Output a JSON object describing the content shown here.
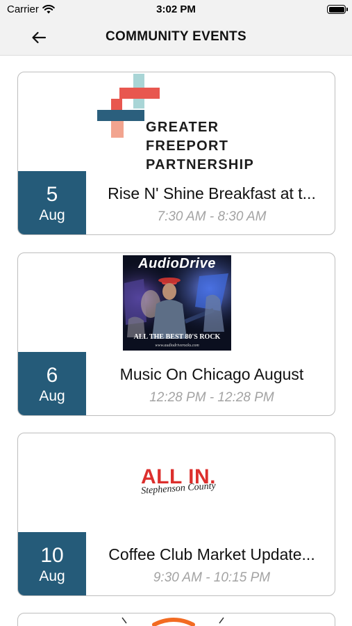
{
  "status_bar": {
    "carrier": "Carrier",
    "time": "3:02 PM",
    "wifi_icon": "wifi-icon",
    "battery_icon": "battery-icon"
  },
  "nav": {
    "title": "COMMUNITY EVENTS",
    "back_icon": "arrow-left-icon"
  },
  "events": [
    {
      "day": "5",
      "month": "Aug",
      "title": "Rise N' Shine Breakfast at t...",
      "time": "7:30 AM - 8:30 AM",
      "image": {
        "kind": "logo",
        "lines": [
          "GREATER",
          "FREEPORT",
          "PARTNERSHIP"
        ]
      }
    },
    {
      "day": "6",
      "month": "Aug",
      "title": "Music On Chicago August",
      "time": "12:28 PM - 12:28 PM",
      "image": {
        "kind": "poster",
        "title": "AudioDrive",
        "tagline": "ALL THE BEST 80'S ROCK",
        "url": "www.audiodriverocks.com"
      }
    },
    {
      "day": "10",
      "month": "Aug",
      "title": "Coffee Club Market Update...",
      "time": "9:30 AM - 10:15 PM",
      "image": {
        "kind": "logo",
        "title": "ALL IN.",
        "subtitle": "Stephenson County"
      }
    }
  ],
  "colors": {
    "date_box": "#255b79",
    "time_text": "#a3a3a3",
    "allin_red": "#dc2f2d",
    "gfp_coral": "#e8574f",
    "gfp_teal": "#2b5f7d",
    "gfp_mint": "#a9d5d6",
    "gfp_peach": "#f2a48f"
  }
}
